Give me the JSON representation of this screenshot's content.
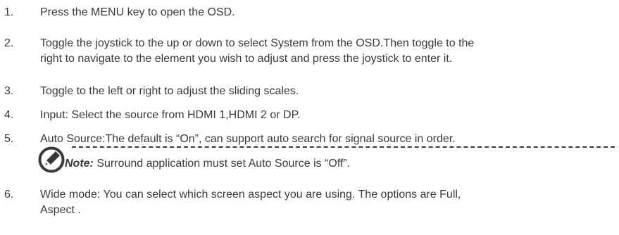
{
  "steps": [
    {
      "num": "1.",
      "lines": [
        "Press the MENU key to open the OSD."
      ]
    },
    {
      "num": "2.",
      "lines": [
        "Toggle the joystick to the up or down to select System from the OSD.Then toggle to the",
        "right to navigate to the element you wish to adjust and press the joystick to enter it."
      ]
    },
    {
      "num": "3.",
      "lines": [
        "Toggle to the left or right to adjust the sliding scales."
      ]
    },
    {
      "num": "4.",
      "lines": [
        "Input: Select the source from HDMI 1,HDMI 2 or DP."
      ]
    },
    {
      "num": "5.",
      "lines": [
        "Auto Source:The default is “On”, can support auto search for signal source in order."
      ]
    },
    {
      "num": "6.",
      "lines": [
        "Wide mode: You can select which screen aspect you are using. The options are Full,",
        "Aspect ."
      ]
    }
  ],
  "note": {
    "label": "Note:",
    "text": " Surround application must set Auto Source is “Off”.",
    "icon": "pen-in-circle-icon"
  }
}
